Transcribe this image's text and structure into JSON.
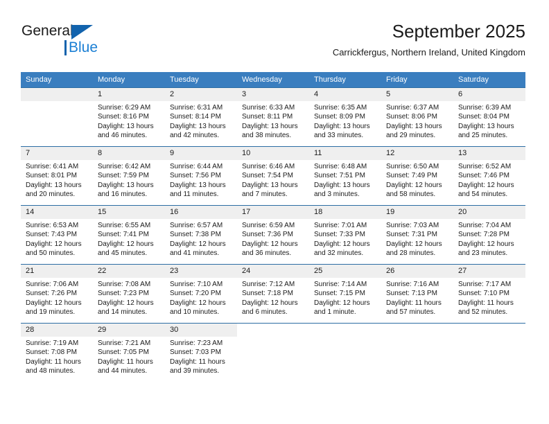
{
  "brand": {
    "word_one": "General",
    "word_two": "Blue",
    "accent_dark": "#1263ad",
    "accent_light": "#1b7fd4"
  },
  "header": {
    "title": "September 2025",
    "location": "Carrickfergus, Northern Ireland, United Kingdom"
  },
  "theme": {
    "header_row_bg": "#3a7ebf",
    "header_row_text": "#ffffff",
    "daynum_bg": "#efefef",
    "row_divider": "#2b6ca3"
  },
  "calendar": {
    "weekday_headers": [
      "Sunday",
      "Monday",
      "Tuesday",
      "Wednesday",
      "Thursday",
      "Friday",
      "Saturday"
    ],
    "weeks": [
      [
        {
          "day": "",
          "sunrise": "",
          "sunset": "",
          "daylight_line1": "",
          "daylight_line2": "",
          "blank": true
        },
        {
          "day": "1",
          "sunrise": "Sunrise: 6:29 AM",
          "sunset": "Sunset: 8:16 PM",
          "daylight_line1": "Daylight: 13 hours",
          "daylight_line2": "and 46 minutes."
        },
        {
          "day": "2",
          "sunrise": "Sunrise: 6:31 AM",
          "sunset": "Sunset: 8:14 PM",
          "daylight_line1": "Daylight: 13 hours",
          "daylight_line2": "and 42 minutes."
        },
        {
          "day": "3",
          "sunrise": "Sunrise: 6:33 AM",
          "sunset": "Sunset: 8:11 PM",
          "daylight_line1": "Daylight: 13 hours",
          "daylight_line2": "and 38 minutes."
        },
        {
          "day": "4",
          "sunrise": "Sunrise: 6:35 AM",
          "sunset": "Sunset: 8:09 PM",
          "daylight_line1": "Daylight: 13 hours",
          "daylight_line2": "and 33 minutes."
        },
        {
          "day": "5",
          "sunrise": "Sunrise: 6:37 AM",
          "sunset": "Sunset: 8:06 PM",
          "daylight_line1": "Daylight: 13 hours",
          "daylight_line2": "and 29 minutes."
        },
        {
          "day": "6",
          "sunrise": "Sunrise: 6:39 AM",
          "sunset": "Sunset: 8:04 PM",
          "daylight_line1": "Daylight: 13 hours",
          "daylight_line2": "and 25 minutes."
        }
      ],
      [
        {
          "day": "7",
          "sunrise": "Sunrise: 6:41 AM",
          "sunset": "Sunset: 8:01 PM",
          "daylight_line1": "Daylight: 13 hours",
          "daylight_line2": "and 20 minutes."
        },
        {
          "day": "8",
          "sunrise": "Sunrise: 6:42 AM",
          "sunset": "Sunset: 7:59 PM",
          "daylight_line1": "Daylight: 13 hours",
          "daylight_line2": "and 16 minutes."
        },
        {
          "day": "9",
          "sunrise": "Sunrise: 6:44 AM",
          "sunset": "Sunset: 7:56 PM",
          "daylight_line1": "Daylight: 13 hours",
          "daylight_line2": "and 11 minutes."
        },
        {
          "day": "10",
          "sunrise": "Sunrise: 6:46 AM",
          "sunset": "Sunset: 7:54 PM",
          "daylight_line1": "Daylight: 13 hours",
          "daylight_line2": "and 7 minutes."
        },
        {
          "day": "11",
          "sunrise": "Sunrise: 6:48 AM",
          "sunset": "Sunset: 7:51 PM",
          "daylight_line1": "Daylight: 13 hours",
          "daylight_line2": "and 3 minutes."
        },
        {
          "day": "12",
          "sunrise": "Sunrise: 6:50 AM",
          "sunset": "Sunset: 7:49 PM",
          "daylight_line1": "Daylight: 12 hours",
          "daylight_line2": "and 58 minutes."
        },
        {
          "day": "13",
          "sunrise": "Sunrise: 6:52 AM",
          "sunset": "Sunset: 7:46 PM",
          "daylight_line1": "Daylight: 12 hours",
          "daylight_line2": "and 54 minutes."
        }
      ],
      [
        {
          "day": "14",
          "sunrise": "Sunrise: 6:53 AM",
          "sunset": "Sunset: 7:43 PM",
          "daylight_line1": "Daylight: 12 hours",
          "daylight_line2": "and 50 minutes."
        },
        {
          "day": "15",
          "sunrise": "Sunrise: 6:55 AM",
          "sunset": "Sunset: 7:41 PM",
          "daylight_line1": "Daylight: 12 hours",
          "daylight_line2": "and 45 minutes."
        },
        {
          "day": "16",
          "sunrise": "Sunrise: 6:57 AM",
          "sunset": "Sunset: 7:38 PM",
          "daylight_line1": "Daylight: 12 hours",
          "daylight_line2": "and 41 minutes."
        },
        {
          "day": "17",
          "sunrise": "Sunrise: 6:59 AM",
          "sunset": "Sunset: 7:36 PM",
          "daylight_line1": "Daylight: 12 hours",
          "daylight_line2": "and 36 minutes."
        },
        {
          "day": "18",
          "sunrise": "Sunrise: 7:01 AM",
          "sunset": "Sunset: 7:33 PM",
          "daylight_line1": "Daylight: 12 hours",
          "daylight_line2": "and 32 minutes."
        },
        {
          "day": "19",
          "sunrise": "Sunrise: 7:03 AM",
          "sunset": "Sunset: 7:31 PM",
          "daylight_line1": "Daylight: 12 hours",
          "daylight_line2": "and 28 minutes."
        },
        {
          "day": "20",
          "sunrise": "Sunrise: 7:04 AM",
          "sunset": "Sunset: 7:28 PM",
          "daylight_line1": "Daylight: 12 hours",
          "daylight_line2": "and 23 minutes."
        }
      ],
      [
        {
          "day": "21",
          "sunrise": "Sunrise: 7:06 AM",
          "sunset": "Sunset: 7:26 PM",
          "daylight_line1": "Daylight: 12 hours",
          "daylight_line2": "and 19 minutes."
        },
        {
          "day": "22",
          "sunrise": "Sunrise: 7:08 AM",
          "sunset": "Sunset: 7:23 PM",
          "daylight_line1": "Daylight: 12 hours",
          "daylight_line2": "and 14 minutes."
        },
        {
          "day": "23",
          "sunrise": "Sunrise: 7:10 AM",
          "sunset": "Sunset: 7:20 PM",
          "daylight_line1": "Daylight: 12 hours",
          "daylight_line2": "and 10 minutes."
        },
        {
          "day": "24",
          "sunrise": "Sunrise: 7:12 AM",
          "sunset": "Sunset: 7:18 PM",
          "daylight_line1": "Daylight: 12 hours",
          "daylight_line2": "and 6 minutes."
        },
        {
          "day": "25",
          "sunrise": "Sunrise: 7:14 AM",
          "sunset": "Sunset: 7:15 PM",
          "daylight_line1": "Daylight: 12 hours",
          "daylight_line2": "and 1 minute."
        },
        {
          "day": "26",
          "sunrise": "Sunrise: 7:16 AM",
          "sunset": "Sunset: 7:13 PM",
          "daylight_line1": "Daylight: 11 hours",
          "daylight_line2": "and 57 minutes."
        },
        {
          "day": "27",
          "sunrise": "Sunrise: 7:17 AM",
          "sunset": "Sunset: 7:10 PM",
          "daylight_line1": "Daylight: 11 hours",
          "daylight_line2": "and 52 minutes."
        }
      ],
      [
        {
          "day": "28",
          "sunrise": "Sunrise: 7:19 AM",
          "sunset": "Sunset: 7:08 PM",
          "daylight_line1": "Daylight: 11 hours",
          "daylight_line2": "and 48 minutes."
        },
        {
          "day": "29",
          "sunrise": "Sunrise: 7:21 AM",
          "sunset": "Sunset: 7:05 PM",
          "daylight_line1": "Daylight: 11 hours",
          "daylight_line2": "and 44 minutes."
        },
        {
          "day": "30",
          "sunrise": "Sunrise: 7:23 AM",
          "sunset": "Sunset: 7:03 PM",
          "daylight_line1": "Daylight: 11 hours",
          "daylight_line2": "and 39 minutes."
        },
        {
          "day": "",
          "sunrise": "",
          "sunset": "",
          "daylight_line1": "",
          "daylight_line2": "",
          "off": true
        },
        {
          "day": "",
          "sunrise": "",
          "sunset": "",
          "daylight_line1": "",
          "daylight_line2": "",
          "off": true
        },
        {
          "day": "",
          "sunrise": "",
          "sunset": "",
          "daylight_line1": "",
          "daylight_line2": "",
          "off": true
        },
        {
          "day": "",
          "sunrise": "",
          "sunset": "",
          "daylight_line1": "",
          "daylight_line2": "",
          "off": true
        }
      ]
    ]
  }
}
